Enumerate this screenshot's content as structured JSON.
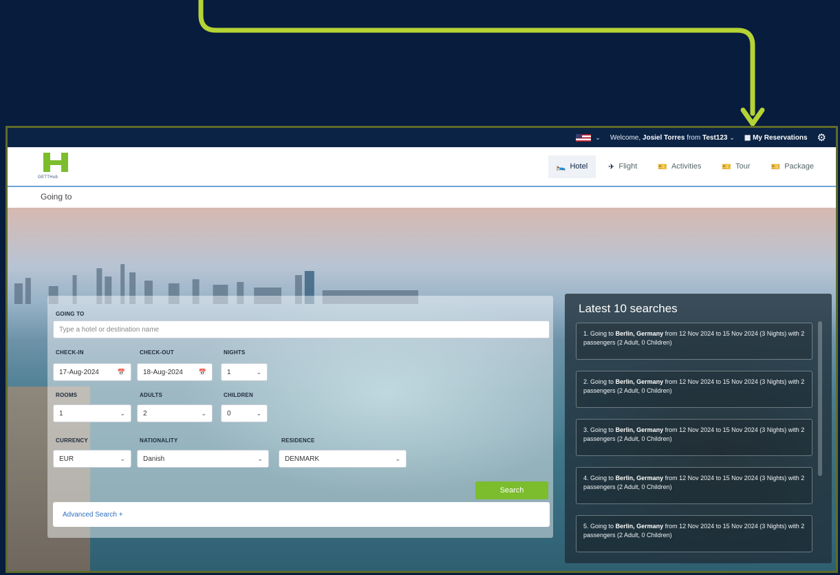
{
  "topbar": {
    "welcome_prefix": "Welcome,",
    "user_name": "Josiel Torres",
    "from_text": "from",
    "company": "Test123",
    "my_reservations": "My Reservations"
  },
  "logo": {
    "text": "GETTHub"
  },
  "nav": {
    "items": [
      {
        "label": "Hotel",
        "icon": "bed-icon"
      },
      {
        "label": "Flight",
        "icon": "plane-icon"
      },
      {
        "label": "Activities",
        "icon": "ticket-icon"
      },
      {
        "label": "Tour",
        "icon": "ticket-icon"
      },
      {
        "label": "Package",
        "icon": "ticket-icon"
      }
    ]
  },
  "page": {
    "going_to_heading": "Going to"
  },
  "search": {
    "going_to_label": "GOING TO",
    "destination_placeholder": "Type a hotel or destination name",
    "checkin_label": "CHECK-IN",
    "checkin_value": "17-Aug-2024",
    "checkout_label": "CHECK-OUT",
    "checkout_value": "18-Aug-2024",
    "nights_label": "NIGHTS",
    "nights_value": "1",
    "rooms_label": "ROOMS",
    "rooms_value": "1",
    "adults_label": "ADULTS",
    "adults_value": "2",
    "children_label": "CHILDREN",
    "children_value": "0",
    "currency_label": "CURRENCY",
    "currency_value": "EUR",
    "nationality_label": "NATIONALITY",
    "nationality_value": "Danish",
    "residence_label": "RESIDENCE",
    "residence_value": "DENMARK",
    "search_button": "Search",
    "advanced_search": "Advanced Search +"
  },
  "latest": {
    "title": "Latest 10 searches",
    "items": [
      {
        "num": "1.",
        "pre": "Going to",
        "city": "Berlin, Germany",
        "rest": "from 12 Nov 2024 to 15 Nov 2024 (3 Nights) with 2 passengers (2 Adult, 0 Children)"
      },
      {
        "num": "2.",
        "pre": "Going to",
        "city": "Berlin, Germany",
        "rest": "from 12 Nov 2024 to 15 Nov 2024 (3 Nights) with 2 passengers (2 Adult, 0 Children)"
      },
      {
        "num": "3.",
        "pre": "Going to",
        "city": "Berlin, Germany",
        "rest": "from 12 Nov 2024 to 15 Nov 2024 (3 Nights) with 2 passengers (2 Adult, 0 Children)"
      },
      {
        "num": "4.",
        "pre": "Going to",
        "city": "Berlin, Germany",
        "rest": "from 12 Nov 2024 to 15 Nov 2024 (3 Nights) with 2 passengers (2 Adult, 0 Children)"
      },
      {
        "num": "5.",
        "pre": "Going to",
        "city": "Berlin, Germany",
        "rest": "from 12 Nov 2024 to 15 Nov 2024 (3 Nights) with 2 passengers (2 Adult, 0 Children)"
      }
    ]
  },
  "colors": {
    "background": "#081c3e",
    "arrow": "#b5d334",
    "accent_green": "#7bbd2c",
    "topbar": "#0b2345",
    "frame_border": "#5f6b2a"
  }
}
